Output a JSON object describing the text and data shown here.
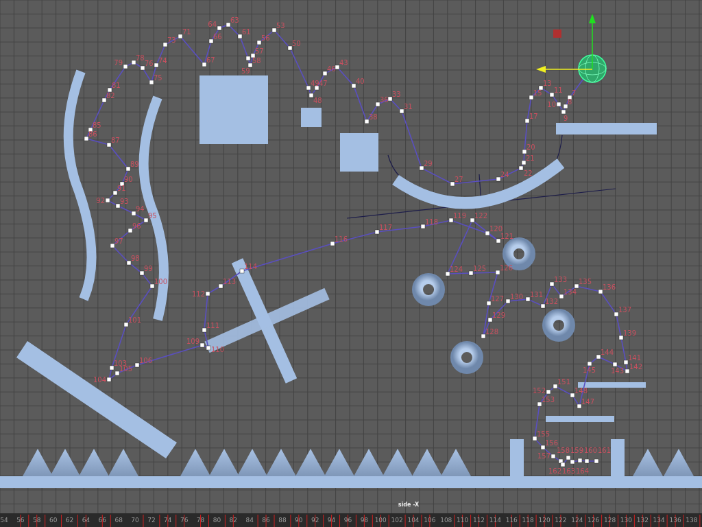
{
  "viewport": {
    "camera_label": "side -X"
  },
  "motion_path": {
    "frame_labels": [
      "7",
      "8",
      "9",
      "10",
      "11",
      "13",
      "15",
      "17",
      "20",
      "21",
      "22",
      "24",
      "27",
      "29",
      "31",
      "33",
      "36",
      "38",
      "40",
      "43",
      "46",
      "47",
      "48",
      "49",
      "50",
      "53",
      "56",
      "57",
      "58",
      "59",
      "61",
      "63",
      "64",
      "66",
      "67",
      "71",
      "73",
      "74",
      "75",
      "76",
      "78",
      "79",
      "81",
      "82",
      "85",
      "86",
      "87",
      "89",
      "90",
      "91",
      "92",
      "93",
      "94",
      "95",
      "96",
      "97",
      "98",
      "99",
      "100",
      "101",
      "103",
      "104",
      "105",
      "106",
      "109",
      "110",
      "111",
      "112",
      "113",
      "114",
      "116",
      "117",
      "118",
      "119",
      "120",
      "121",
      "122",
      "124",
      "125",
      "126",
      "127",
      "128",
      "129",
      "130",
      "131",
      "132",
      "133",
      "134",
      "135",
      "136",
      "137",
      "139",
      "141",
      "142",
      "143",
      "144",
      "145",
      "147",
      "148",
      "151",
      "152",
      "153",
      "155",
      "156",
      "157",
      "158",
      "159",
      "160",
      "161",
      "162",
      "163",
      "164"
    ]
  },
  "timeline": {
    "ticks": [
      "54",
      "56",
      "58",
      "60",
      "62",
      "64",
      "66",
      "68",
      "70",
      "72",
      "74",
      "76",
      "78",
      "80",
      "82",
      "84",
      "86",
      "88",
      "90",
      "92",
      "94",
      "96",
      "98",
      "100",
      "102",
      "104",
      "106",
      "108",
      "110",
      "112",
      "114",
      "116",
      "118",
      "120",
      "122",
      "124",
      "126",
      "128",
      "130",
      "132",
      "134",
      "136",
      "138"
    ]
  }
}
